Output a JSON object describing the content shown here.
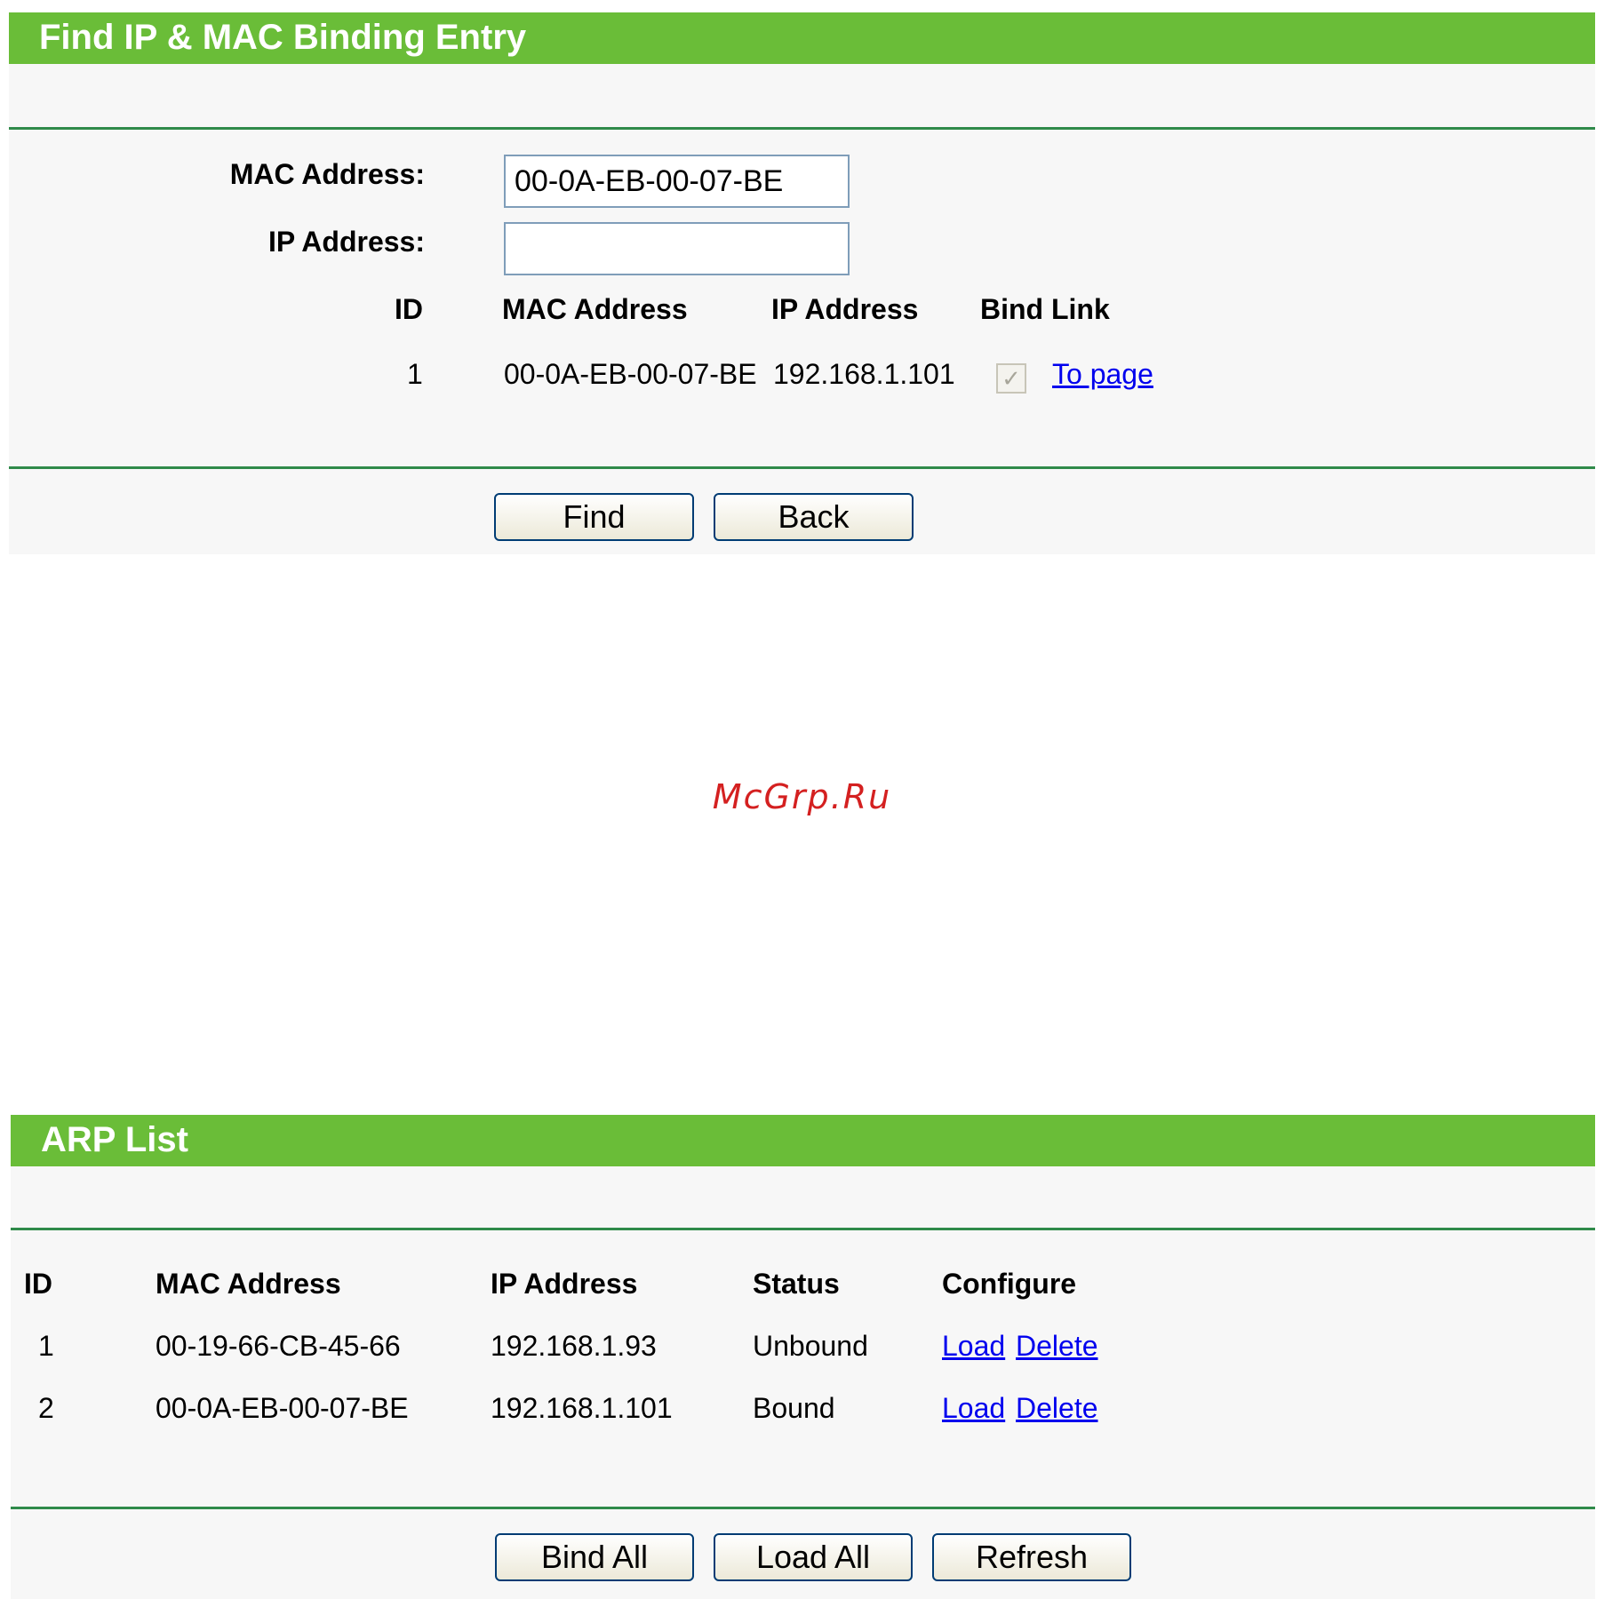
{
  "find_section": {
    "title": "Find IP & MAC Binding Entry",
    "mac_label": "MAC Address:",
    "mac_value": "00-0A-EB-00-07-BE",
    "ip_label": "IP Address:",
    "ip_value": "",
    "columns": {
      "id": "ID",
      "mac": "MAC Address",
      "ip": "IP Address",
      "bind_link": "Bind Link"
    },
    "result": {
      "id": "1",
      "mac": "00-0A-EB-00-07-BE",
      "ip": "192.168.1.101",
      "bound": true,
      "link_label": "To page"
    },
    "buttons": {
      "find": "Find",
      "back": "Back"
    }
  },
  "watermark": "McGrp.Ru",
  "arp_section": {
    "title": "ARP List",
    "columns": {
      "id": "ID",
      "mac": "MAC Address",
      "ip": "IP Address",
      "status": "Status",
      "configure": "Configure"
    },
    "rows": [
      {
        "id": "1",
        "mac": "00-19-66-CB-45-66",
        "ip": "192.168.1.93",
        "status": "Unbound",
        "load": "Load",
        "delete": "Delete"
      },
      {
        "id": "2",
        "mac": "00-0A-EB-00-07-BE",
        "ip": "192.168.1.101",
        "status": "Bound",
        "load": "Load",
        "delete": "Delete"
      }
    ],
    "buttons": {
      "bind_all": "Bind All",
      "load_all": "Load All",
      "refresh": "Refresh"
    }
  },
  "colors": {
    "header_green": "#6abd38",
    "rule_green": "#2f8a4a",
    "link_blue": "#0000ee",
    "watermark_red": "#d42020"
  }
}
